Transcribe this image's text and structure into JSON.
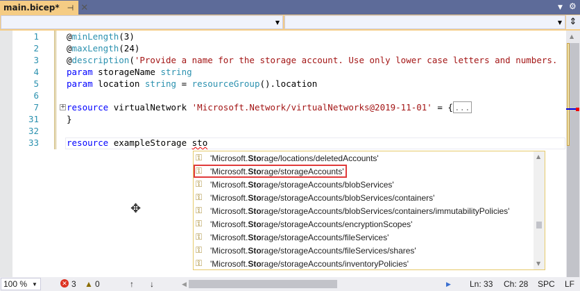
{
  "tab": {
    "title": "main.bicep*",
    "pin": "⊣",
    "close": "✕"
  },
  "lines": [
    {
      "num": "1"
    },
    {
      "num": "2"
    },
    {
      "num": "3"
    },
    {
      "num": "4"
    },
    {
      "num": "5"
    },
    {
      "num": "6"
    },
    {
      "num": "7"
    },
    {
      "num": "31"
    },
    {
      "num": "32"
    },
    {
      "num": "33"
    }
  ],
  "code": {
    "l1a": "@",
    "l1b": "minLength",
    "l1c": "(3)",
    "l2a": "@",
    "l2b": "maxLength",
    "l2c": "(24)",
    "l3a": "@",
    "l3b": "description",
    "l3c": "(",
    "l3d": "'Provide a name for the storage account. Use only lower case letters and numbers.",
    "l4a": "param",
    "l4b": " storageName ",
    "l4c": "string",
    "l5a": "param",
    "l5b": " location ",
    "l5c": "string",
    "l5d": " = ",
    "l5e": "resourceGroup",
    "l5f": "().location",
    "l7a": "resource",
    "l7b": " virtualNetwork ",
    "l7c": "'Microsoft.Network/virtualNetworks@2019-11-01'",
    "l7d": " = {",
    "l7e": "...",
    "l31": "}",
    "l33a": "resource",
    "l33b": " exampleStorage ",
    "l33c": "sto"
  },
  "completion": {
    "prefix": "'Microsoft.",
    "match": "Sto",
    "items": [
      "rage/locations/deletedAccounts'",
      "rage/storageAccounts'",
      "rage/storageAccounts/blobServices'",
      "rage/storageAccounts/blobServices/containers'",
      "rage/storageAccounts/blobServices/containers/immutabilityPolicies'",
      "rage/storageAccounts/encryptionScopes'",
      "rage/storageAccounts/fileServices'",
      "rage/storageAccounts/fileServices/shares'",
      "rage/storageAccounts/inventoryPolicies'"
    ]
  },
  "status": {
    "zoom": "100 %",
    "errors": "3",
    "warnings": "0",
    "ln": "Ln: 33",
    "ch": "Ch: 28",
    "spc": "SPC",
    "lf": "LF"
  }
}
